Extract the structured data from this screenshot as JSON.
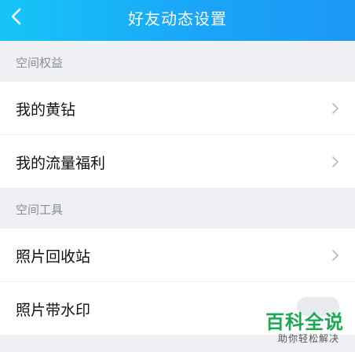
{
  "header": {
    "title": "好友动态设置",
    "back_icon": "chevron-left-icon"
  },
  "sections": [
    {
      "title": "空间权益",
      "items": [
        {
          "label": "我的黄钻",
          "icon": "chevron-right-icon"
        },
        {
          "label": "我的流量福利",
          "icon": "chevron-right-icon"
        }
      ]
    },
    {
      "title": "空间工具",
      "items": [
        {
          "label": "照片回收站",
          "icon": "chevron-right-icon"
        },
        {
          "label": "照片带水印",
          "control": "toggle"
        }
      ]
    }
  ],
  "watermark": {
    "main": "百科全说",
    "sub": "助你轻松解决"
  },
  "colors": {
    "header_gradient_start": "#16c5f7",
    "header_gradient_end": "#1b97f5",
    "page_background": "#eef0f3",
    "watermark_green": "#1aa854"
  }
}
